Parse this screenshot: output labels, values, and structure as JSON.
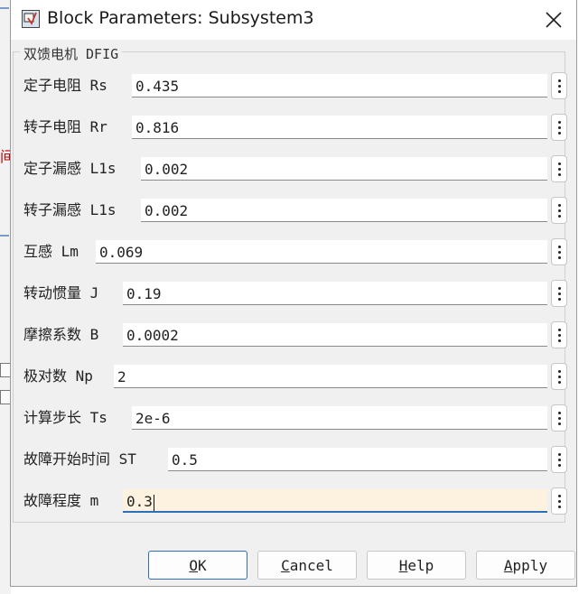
{
  "window": {
    "title": "Block Parameters: Subsystem3"
  },
  "background": {
    "red_glyph": "间"
  },
  "group": {
    "legend": "双馈电机 DFIG"
  },
  "params": [
    {
      "label": "定子电阻 Rs",
      "value": "0.435"
    },
    {
      "label": "转子电阻 Rr",
      "value": "0.816"
    },
    {
      "label": "定子漏感 L1s",
      "value": "0.002"
    },
    {
      "label": "转子漏感 L1s",
      "value": "0.002"
    },
    {
      "label": "互感 Lm",
      "value": "0.069"
    },
    {
      "label": "转动惯量 J",
      "value": "0.19"
    },
    {
      "label": "摩擦系数 B",
      "value": "0.0002"
    },
    {
      "label": "极对数 Np",
      "value": "2"
    },
    {
      "label": "计算步长 Ts",
      "value": "2e-6"
    },
    {
      "label": "故障开始时间 ST",
      "value": "0.5"
    },
    {
      "label": "故障程度 m",
      "value": "0.3"
    }
  ],
  "buttons": {
    "ok": {
      "mnemonic": "O",
      "rest": "K"
    },
    "cancel": {
      "mnemonic": "C",
      "rest": "ancel"
    },
    "help": {
      "mnemonic": "H",
      "rest": "elp"
    },
    "apply": {
      "mnemonic": "A",
      "rest": "pply"
    }
  },
  "colors": {
    "accent": "#2e6fb8",
    "active_field": "#fdf2e0",
    "dialog_bg": "#f0f0f0"
  },
  "icons": [
    "simulink-block-icon",
    "close-icon",
    "more-options-icon"
  ]
}
